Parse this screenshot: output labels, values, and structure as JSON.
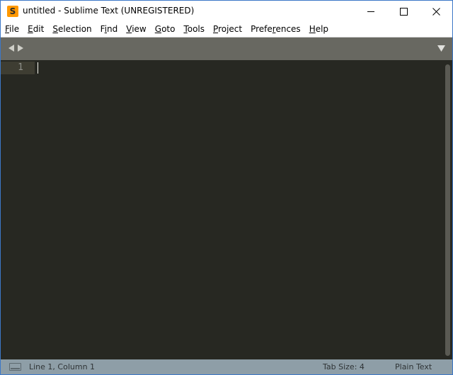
{
  "window": {
    "title": "untitled - Sublime Text (UNREGISTERED)",
    "app_icon_glyph": "S",
    "icons": {
      "app": "sublime-text-icon",
      "minimize": "minimize-icon",
      "maximize": "maximize-icon",
      "close": "close-icon"
    }
  },
  "menu": {
    "items": [
      {
        "access": "F",
        "rest": "ile"
      },
      {
        "access": "E",
        "rest": "dit"
      },
      {
        "access": "S",
        "rest": "election"
      },
      {
        "pre": "F",
        "access": "i",
        "rest": "nd"
      },
      {
        "access": "V",
        "rest": "iew"
      },
      {
        "access": "G",
        "rest": "oto"
      },
      {
        "access": "T",
        "rest": "ools"
      },
      {
        "access": "P",
        "rest": "roject"
      },
      {
        "pre": "Prefe",
        "access": "r",
        "rest": "ences"
      },
      {
        "access": "H",
        "rest": "elp"
      }
    ]
  },
  "tabbar": {
    "icons": {
      "back": "nav-left-arrow-icon",
      "forward": "nav-right-arrow-icon",
      "dropdown": "tab-list-dropdown-icon"
    }
  },
  "editor": {
    "line_numbers": [
      "1"
    ],
    "content": ""
  },
  "statusbar": {
    "position": "Line 1, Column 1",
    "tab_size": "Tab Size: 4",
    "syntax": "Plain Text",
    "icon": "panel-toggle-icon"
  },
  "colors": {
    "editor_bg": "#272822",
    "tabbar_bg": "#686861",
    "statusbar_bg": "#8e9ea7",
    "app_icon": "#ff9800"
  }
}
